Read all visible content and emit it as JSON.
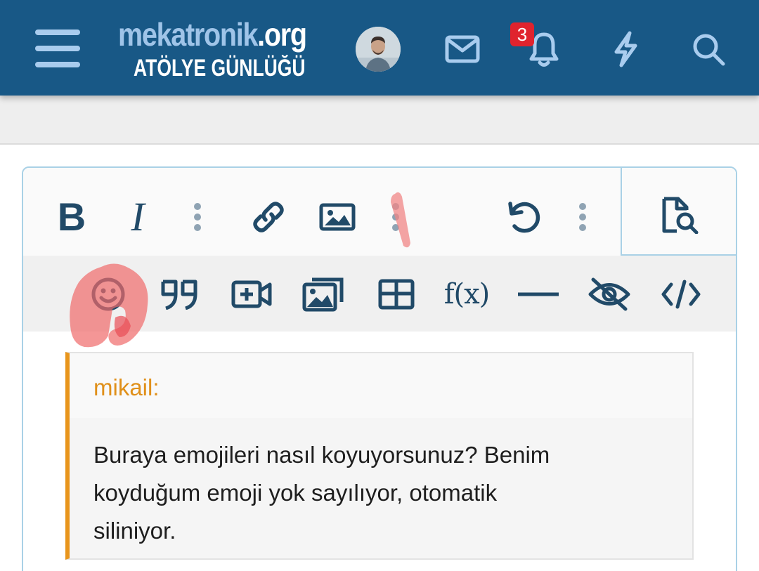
{
  "header": {
    "logo_main": "mekatronik",
    "logo_tld": ".org",
    "logo_sub": "ATÖLYE GÜNLÜĞÜ",
    "notification_count": "3",
    "icons": [
      "menu-icon",
      "avatar",
      "envelope-icon",
      "bell-icon",
      "bolt-icon",
      "search-icon"
    ],
    "colors": {
      "bar": "#185886",
      "badge": "#e0232e"
    }
  },
  "editor": {
    "row1": {
      "bold": "B",
      "italic": "I",
      "icons": [
        "more-vertical-icon",
        "link-icon",
        "image-icon",
        "more-vertical-icon",
        "undo-icon",
        "more-vertical-icon",
        "preview-icon"
      ]
    },
    "row2": {
      "function_label": "f(x)",
      "icons": [
        "smiley-icon",
        "quote-icon",
        "video-plus-icon",
        "gallery-icon",
        "table-icon",
        "function-icon",
        "horizontal-rule-icon",
        "eye-slash-icon",
        "code-icon"
      ]
    }
  },
  "quote": {
    "author": "mikail:",
    "body_lines": [
      "Buraya emojileri nasıl koyuyorsunuz? Benim",
      "koyduğum emoji yok sayılıyor, otomatik",
      "siliniyor."
    ],
    "accent_color": "#e8951c"
  }
}
